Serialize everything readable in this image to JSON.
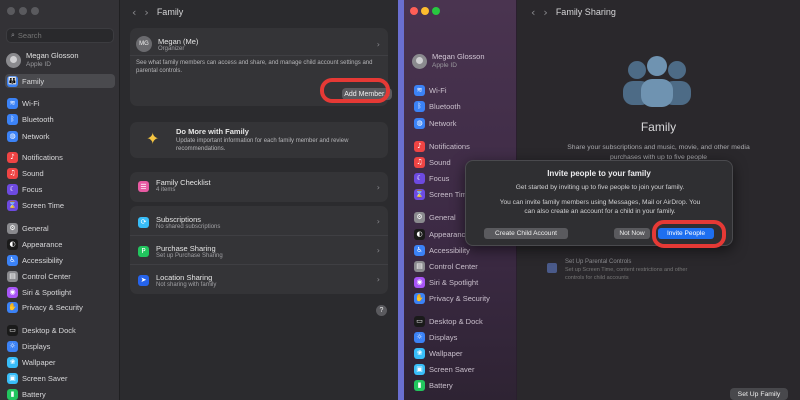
{
  "left": {
    "search_placeholder": "Search",
    "account": {
      "name": "Megan Glosson",
      "sub": "Apple ID"
    },
    "sidebar": [
      {
        "label": "Family",
        "icon": "family-icon",
        "color": "#3b82f6",
        "selected": true
      },
      {
        "label": "Wi-Fi",
        "icon": "wifi-icon",
        "color": "#3b82f6"
      },
      {
        "label": "Bluetooth",
        "icon": "bluetooth-icon",
        "color": "#3b82f6"
      },
      {
        "label": "Network",
        "icon": "network-icon",
        "color": "#3b82f6"
      },
      {
        "label": "Notifications",
        "icon": "bell-icon",
        "color": "#ef4444"
      },
      {
        "label": "Sound",
        "icon": "speaker-icon",
        "color": "#ef4444"
      },
      {
        "label": "Focus",
        "icon": "moon-icon",
        "color": "#6d4ae0"
      },
      {
        "label": "Screen Time",
        "icon": "hourglass-icon",
        "color": "#6d4ae0"
      },
      {
        "label": "General",
        "icon": "gear-icon",
        "color": "#8a8a8e"
      },
      {
        "label": "Appearance",
        "icon": "appearance-icon",
        "color": "#1a1a1a"
      },
      {
        "label": "Accessibility",
        "icon": "accessibility-icon",
        "color": "#3b82f6"
      },
      {
        "label": "Control Center",
        "icon": "control-center-icon",
        "color": "#8a8a8e"
      },
      {
        "label": "Siri & Spotlight",
        "icon": "siri-icon",
        "color": "#a855f7"
      },
      {
        "label": "Privacy & Security",
        "icon": "hand-icon",
        "color": "#3b82f6"
      },
      {
        "label": "Desktop & Dock",
        "icon": "dock-icon",
        "color": "#1a1a1a"
      },
      {
        "label": "Displays",
        "icon": "display-icon",
        "color": "#3b82f6"
      },
      {
        "label": "Wallpaper",
        "icon": "wallpaper-icon",
        "color": "#38bdf8"
      },
      {
        "label": "Screen Saver",
        "icon": "screensaver-icon",
        "color": "#38bdf8"
      },
      {
        "label": "Battery",
        "icon": "battery-icon",
        "color": "#22c55e"
      }
    ],
    "title": "Family",
    "member": {
      "initials": "MG",
      "name": "Megan (Me)",
      "role": "Organizer"
    },
    "family_desc": "See what family members can access and share, and manage child account settings and parental controls.",
    "add_member": "Add Member...",
    "do_more": {
      "title": "Do More with Family",
      "desc": "Update important information for each family member and review recommendations."
    },
    "checklist": {
      "title": "Family Checklist",
      "sub": "4 items"
    },
    "subscriptions": {
      "title": "Subscriptions",
      "sub": "No shared subscriptions"
    },
    "purchase": {
      "title": "Purchase Sharing",
      "sub": "Set up Purchase Sharing"
    },
    "location": {
      "title": "Location Sharing",
      "sub": "Not sharing with family"
    },
    "help": "?"
  },
  "right": {
    "account": {
      "name": "Megan Glosson",
      "sub": "Apple ID"
    },
    "sidebar": [
      {
        "label": "Wi-Fi",
        "icon": "wifi-icon",
        "color": "#3b82f6"
      },
      {
        "label": "Bluetooth",
        "icon": "bluetooth-icon",
        "color": "#3b82f6"
      },
      {
        "label": "Network",
        "icon": "network-icon",
        "color": "#3b82f6"
      },
      {
        "label": "Notifications",
        "icon": "bell-icon",
        "color": "#ef4444"
      },
      {
        "label": "Sound",
        "icon": "speaker-icon",
        "color": "#ef4444"
      },
      {
        "label": "Focus",
        "icon": "moon-icon",
        "color": "#6d4ae0"
      },
      {
        "label": "Screen Time",
        "icon": "hourglass-icon",
        "color": "#6d4ae0"
      },
      {
        "label": "General",
        "icon": "gear-icon",
        "color": "#8a8a8e"
      },
      {
        "label": "Appearance",
        "icon": "appearance-icon",
        "color": "#1a1a1a"
      },
      {
        "label": "Accessibility",
        "icon": "accessibility-icon",
        "color": "#3b82f6"
      },
      {
        "label": "Control Center",
        "icon": "control-center-icon",
        "color": "#8a8a8e"
      },
      {
        "label": "Siri & Spotlight",
        "icon": "siri-icon",
        "color": "#a855f7"
      },
      {
        "label": "Privacy & Security",
        "icon": "hand-icon",
        "color": "#3b82f6"
      },
      {
        "label": "Desktop & Dock",
        "icon": "dock-icon",
        "color": "#1a1a1a"
      },
      {
        "label": "Displays",
        "icon": "display-icon",
        "color": "#3b82f6"
      },
      {
        "label": "Wallpaper",
        "icon": "wallpaper-icon",
        "color": "#38bdf8"
      },
      {
        "label": "Screen Saver",
        "icon": "screensaver-icon",
        "color": "#38bdf8"
      },
      {
        "label": "Battery",
        "icon": "battery-icon",
        "color": "#22c55e"
      }
    ],
    "title": "Family Sharing",
    "hero_title": "Family",
    "hero_desc_1": "Share your subscriptions and music, movie, and other media",
    "hero_desc_2": "purchases with up to five people",
    "parental": {
      "title": "Set Up Parental Controls",
      "line1": "Set up Screen Time, content restrictions and other",
      "line2": "controls for child accounts"
    },
    "setup_button": "Set Up Family",
    "dialog": {
      "title": "Invite people to your family",
      "line1": "Get started by inviting up to five people to join your family.",
      "line2": "You can invite family members using Messages, Mail or AirDrop. You",
      "line3": "can also create an account for a child in your family.",
      "create_child": "Create Child Account",
      "not_now": "Not Now",
      "invite": "Invite People"
    }
  },
  "colors": {
    "highlight": "#e53935",
    "accent": "#1e6ff0",
    "divider": "#6a6fd0"
  }
}
